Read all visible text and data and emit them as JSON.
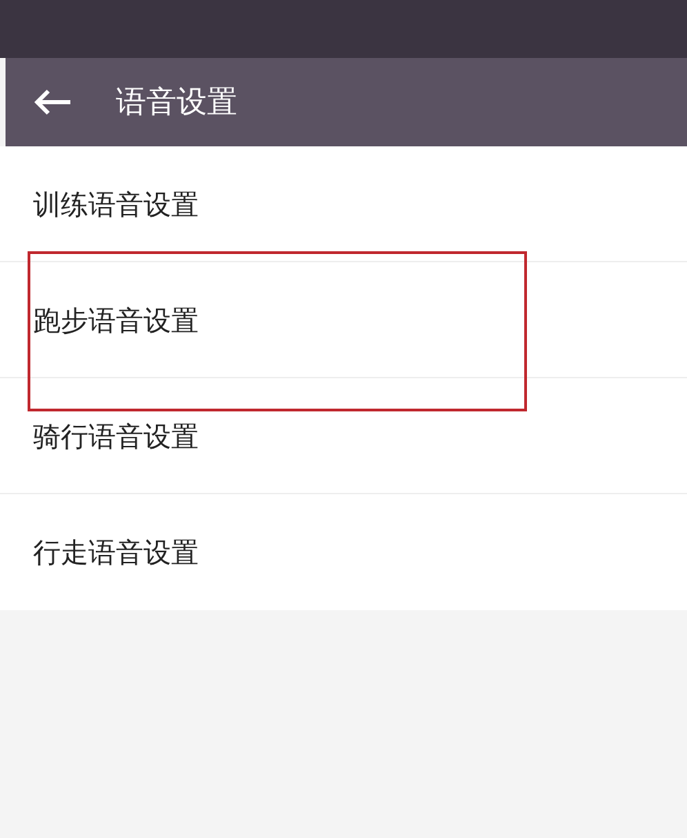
{
  "toolbar": {
    "back_icon": true,
    "title": "语音设置"
  },
  "items": [
    {
      "label": "训练语音设置",
      "highlighted": false
    },
    {
      "label": "跑步语音设置",
      "highlighted": true
    },
    {
      "label": "骑行语音设置",
      "highlighted": false
    },
    {
      "label": "行走语音设置",
      "highlighted": false
    }
  ]
}
